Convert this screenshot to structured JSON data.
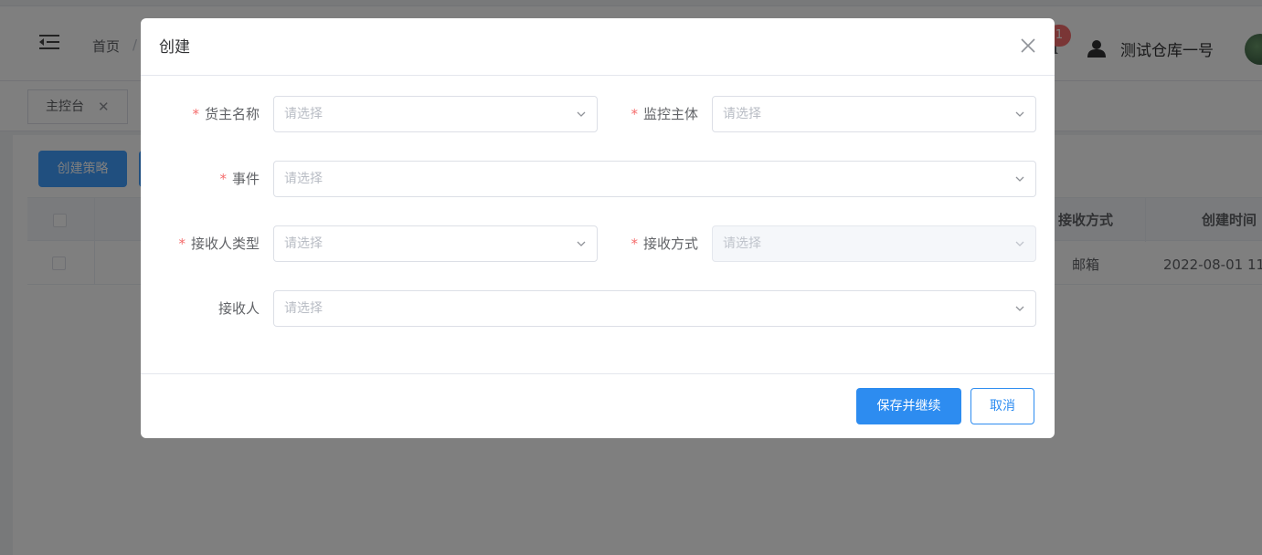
{
  "header": {
    "breadcrumb_home": "首页",
    "breadcrumb_sep": "/",
    "notification_count": "1",
    "user_name": "测试仓库一号"
  },
  "tags": {
    "active_tab": "主控台",
    "close_glyph": "✕"
  },
  "toolbar": {
    "create_policy_label": "创建策略"
  },
  "table": {
    "columns": [
      "接收方式",
      "创建时间"
    ],
    "rows": [
      {
        "receive_method": "邮箱",
        "created_at": "2022-08-01 11:"
      }
    ]
  },
  "dialog": {
    "title": "创建",
    "fields": {
      "owner_name": {
        "label": "货主名称",
        "required": true,
        "placeholder": "请选择"
      },
      "monitor_subject": {
        "label": "监控主体",
        "required": true,
        "placeholder": "请选择"
      },
      "event": {
        "label": "事件",
        "required": true,
        "placeholder": "请选择"
      },
      "receiver_type": {
        "label": "接收人类型",
        "required": true,
        "placeholder": "请选择"
      },
      "receive_method": {
        "label": "接收方式",
        "required": true,
        "placeholder": "请选择",
        "disabled": true
      },
      "receiver": {
        "label": "接收人",
        "required": false,
        "placeholder": "请选择"
      }
    },
    "required_mark": "*",
    "save_continue_label": "保存并继续",
    "cancel_label": "取消"
  },
  "colors": {
    "primary": "#2d8cf0",
    "required": "#f56c6c",
    "badge": "#f56c6c",
    "overlay": "rgba(0,0,0,0.5)"
  },
  "icons": [
    "menu-fold-icon",
    "bell-icon",
    "user-icon",
    "close-icon",
    "chevron-down-icon"
  ]
}
